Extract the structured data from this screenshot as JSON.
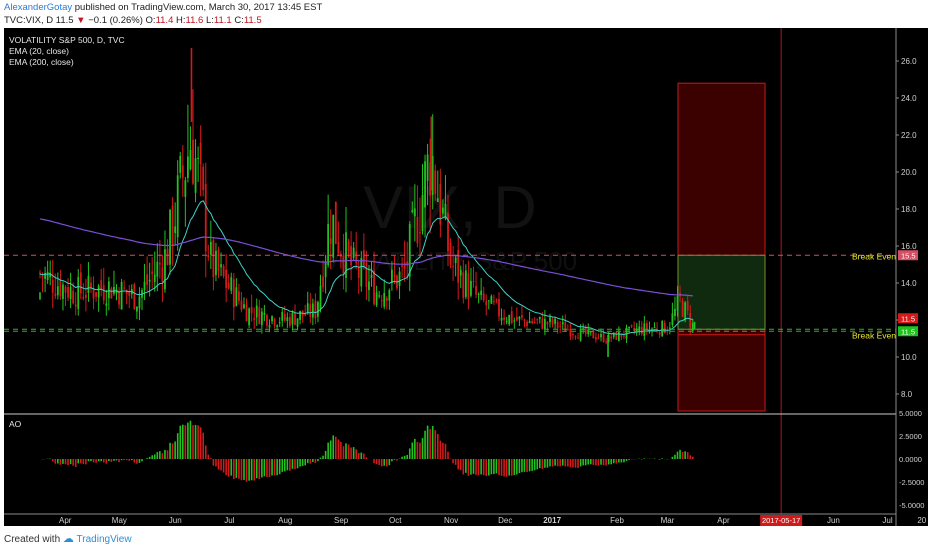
{
  "header": {
    "user": "AlexanderGotay",
    "published_text": "published on TradingView.com, March 30, 2017 13:45 EST",
    "symbol": "TVC:VIX, D",
    "last": "11.5",
    "change": "−0.1 (0.26%)",
    "o_label": "O:",
    "o": "11.4",
    "h_label": "H:",
    "h": "11.6",
    "l_label": "L:",
    "l": "11.1",
    "c_label": "C:",
    "c": "11.5"
  },
  "legend": {
    "line1": "VOLATILITY S&P 500, D, TVC",
    "line2": "EMA (20, close)",
    "line3": "EMA (200, close)"
  },
  "watermark": {
    "big": "VIX, D",
    "small": "VOLATILITY S&P 500"
  },
  "ao_label": "AO",
  "footer": {
    "created": "Created with",
    "brand": "TradingView"
  },
  "colors": {
    "background": "#000000",
    "up": "#22c31f",
    "down": "#d51a1a",
    "ema20": "#3fd1c8",
    "ema200": "#7d4fd8",
    "break_even_line": "#d34f63",
    "green_line": "#38a83a",
    "break_even_text": "#e8e832",
    "stop_zone": "#3b0000",
    "target_zone": "#0f2a0f",
    "date_badge": "#d01919"
  },
  "chart_data": [
    {
      "type": "candlestick",
      "title": "VOLATILITY S&P 500, D, TVC",
      "ylim": [
        7,
        27
      ],
      "y_ticks": [
        "26.0",
        "24.0",
        "22.0",
        "20.0",
        "18.0",
        "16.0",
        "14.0",
        "12.0",
        "10.0",
        "8.0"
      ],
      "x_ticks": [
        "Apr",
        "May",
        "Jun",
        "Jul",
        "Aug",
        "Sep",
        "Oct",
        "Nov",
        "Dec",
        "2017",
        "Feb",
        "Mar",
        "Apr",
        "May",
        "Jun",
        "Jul",
        "20"
      ],
      "highlighted_date": "2017-05-17",
      "series": [
        {
          "name": "VOLATILITY S&P 500",
          "kind": "ohlc"
        },
        {
          "name": "EMA (20, close)",
          "kind": "line"
        },
        {
          "name": "EMA (200, close)",
          "kind": "line"
        }
      ],
      "key_points": [
        {
          "date": "2016-04-01",
          "close": 13.1
        },
        {
          "date": "2016-06-24",
          "high": 26.7
        },
        {
          "date": "2016-11-04",
          "high": 23.0
        },
        {
          "date": "2017-02-10",
          "low": 10.0
        },
        {
          "date": "2017-03-30",
          "close": 11.5
        }
      ],
      "levels": [
        {
          "label": "Break Even",
          "value": 15.5
        },
        {
          "label": "Break Even",
          "value": 11.5
        },
        {
          "label": "",
          "value": 11.5
        }
      ],
      "price_badges": [
        "15.5",
        "11.5",
        "11.5"
      ],
      "zones": [
        {
          "kind": "stop",
          "from": 11.2,
          "to": 24.8
        },
        {
          "kind": "target",
          "from": 11.5,
          "to": 15.5
        },
        {
          "kind": "stop",
          "from": 5.0,
          "to": 11.2
        }
      ]
    },
    {
      "type": "bar",
      "title": "AO",
      "ylim": [
        -7,
        5
      ],
      "y_ticks": [
        "5.0000",
        "2.5000",
        "0.0000",
        "-2.5000",
        "-5.0000"
      ]
    }
  ]
}
